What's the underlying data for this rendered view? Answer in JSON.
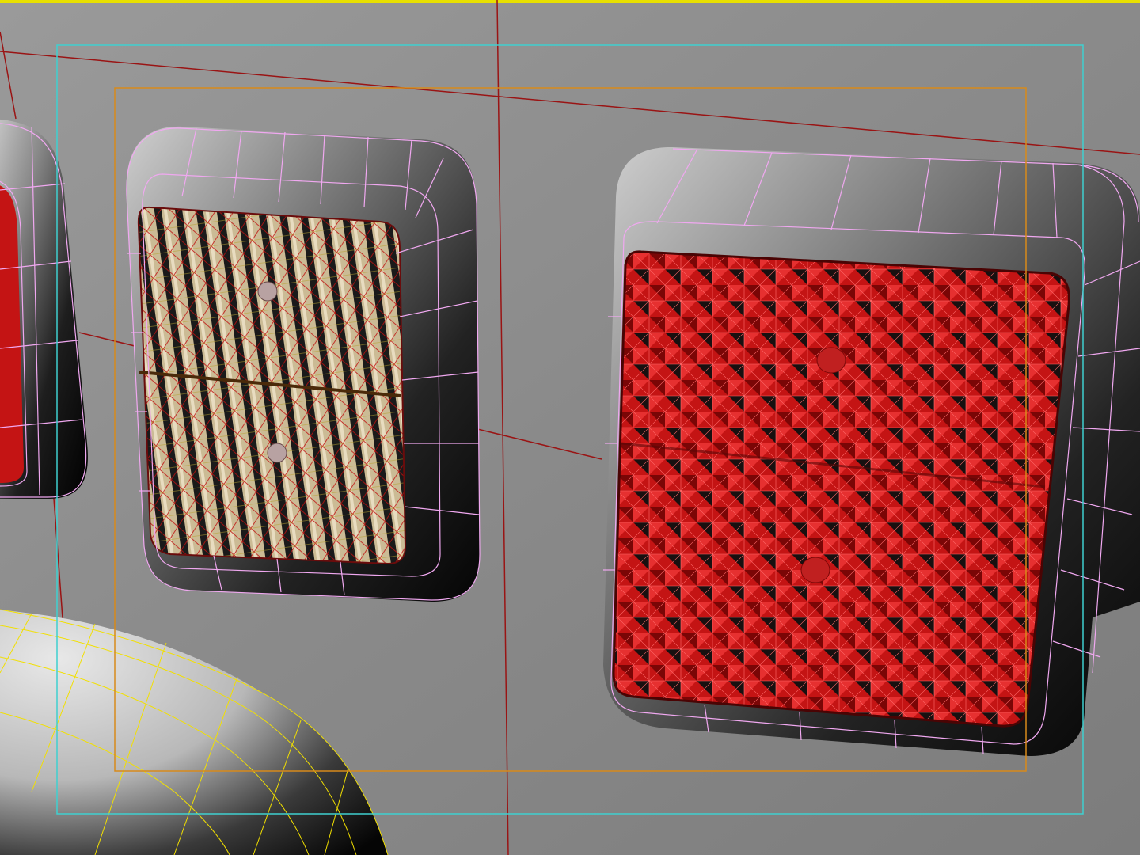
{
  "viewport": {
    "active_border_color": "#e8e000",
    "background_color": "#8a8a8a"
  },
  "guides": {
    "safe_frame_color": "#3fd0d0",
    "title_safe_color": "#d88a1a",
    "axis_line_color": "#9a1414"
  },
  "objects": {
    "wireframe_color": "#f0a8f0",
    "lens_wire_color": "#c81010",
    "bumper_wire_color": "#f2e000",
    "lamp_amber": {
      "name_icon": "amber-lamp",
      "lens_color": "#d8c8a0",
      "selected": true
    },
    "lamp_red": {
      "name_icon": "red-lamp",
      "lens_color": "#c41414",
      "selected": true
    },
    "lamp_left_partial": {
      "name_icon": "partial-lamp",
      "lens_color": "#c41414",
      "selected": true
    },
    "bumper": {
      "name_icon": "bumper-mesh",
      "selected": true
    }
  }
}
